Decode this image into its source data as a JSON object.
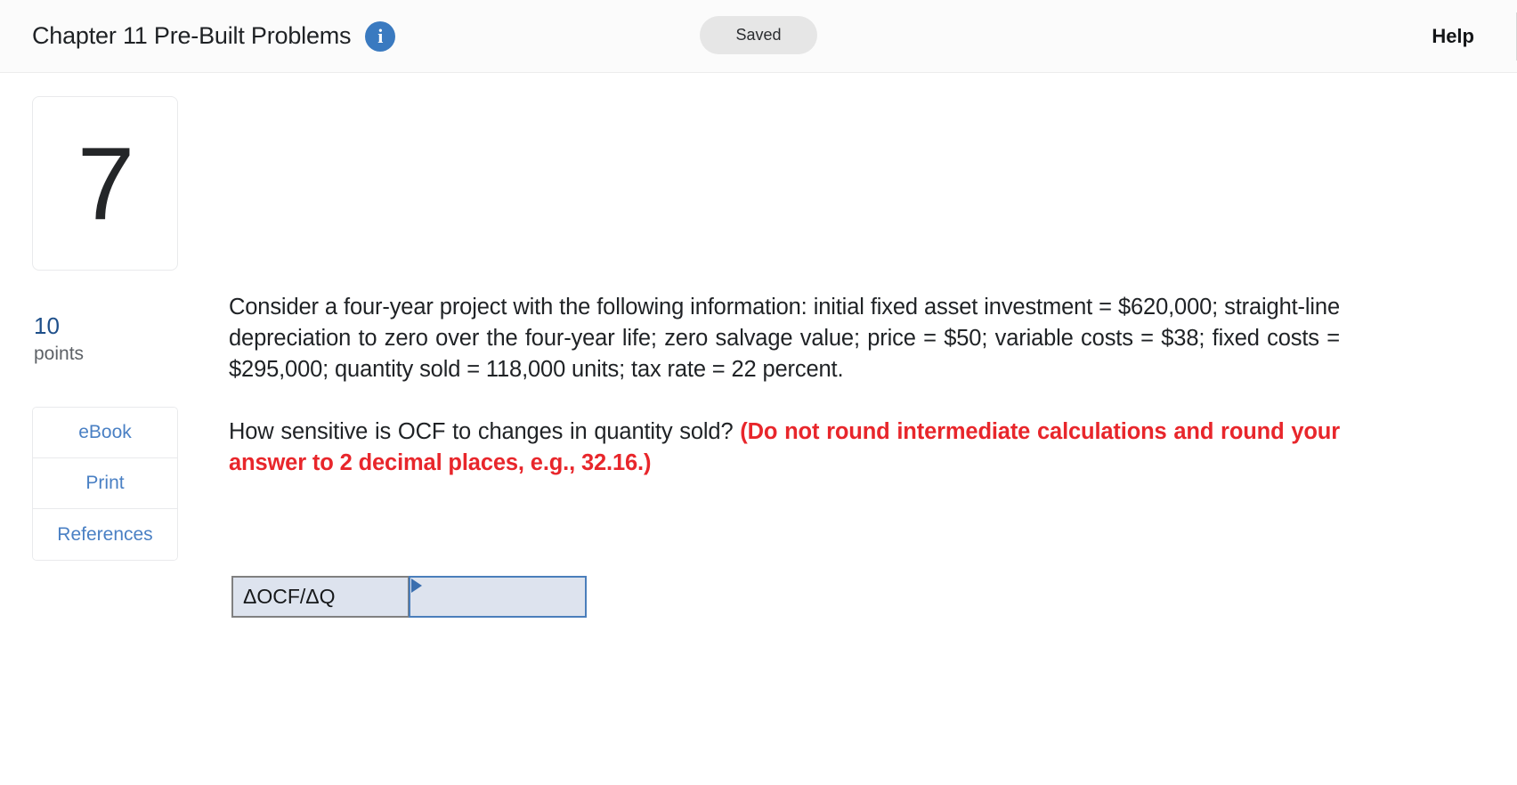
{
  "header": {
    "title": "Chapter 11 Pre-Built Problems",
    "info_icon": "info-icon",
    "saved_label": "Saved",
    "help_label": "Help"
  },
  "rail": {
    "question_number": "7",
    "points_value": "10",
    "points_label": "points",
    "tools": [
      {
        "label": "eBook"
      },
      {
        "label": "Print"
      },
      {
        "label": "References"
      }
    ]
  },
  "question": {
    "intro": "Consider a four-year project with the following information: initial fixed asset investment = $620,000; straight-line depreciation to zero over the four-year life; zero salvage value; price = $50; variable costs = $38; fixed costs = $295,000; quantity sold = 118,000 units; tax rate = 22 percent.",
    "ask_plain": "How sensitive is OCF to changes in quantity sold?",
    "ask_red": "(Do not round intermediate calculations and round your answer to 2 decimal places, e.g., 32.16.)"
  },
  "answer": {
    "row_label": "ΔOCF/ΔQ",
    "input_value": "",
    "input_placeholder": ""
  },
  "colors": {
    "accent_blue": "#3a7ac0",
    "link_blue": "#4a80c4",
    "points_blue": "#1e4f8a",
    "alert_red": "#e8262b",
    "cell_fill": "#dde3ee",
    "cell_border_active": "#4a7ebb",
    "cell_border_label": "#808080",
    "badge_gray": "#e6e6e6"
  }
}
